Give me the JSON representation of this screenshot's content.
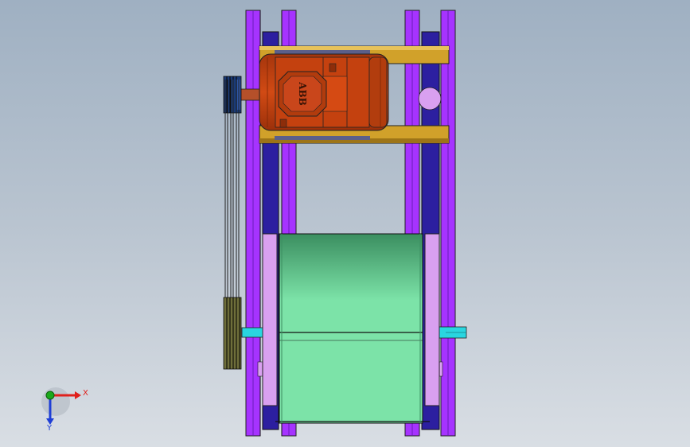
{
  "viewport": {
    "background_top": "#9fb0c2",
    "background_bottom": "#d9dee4"
  },
  "triad": {
    "x_label": "X",
    "y_label": "Y",
    "x_color": "#e0201c",
    "y_color": "#1f3fd6",
    "origin_color": "#1ba91b"
  },
  "model": {
    "frame_color": "#a633ff",
    "rail_color": "#2c1fa0",
    "motor_color": "#c4410f",
    "motor_brand": "ABB",
    "bracket_color": "#d1a12a",
    "drum_color": "#7ce3a8",
    "bearing_color": "#d9a0f0",
    "shaft_color": "#29d6e0",
    "belt_color": "#2a2a2a"
  }
}
